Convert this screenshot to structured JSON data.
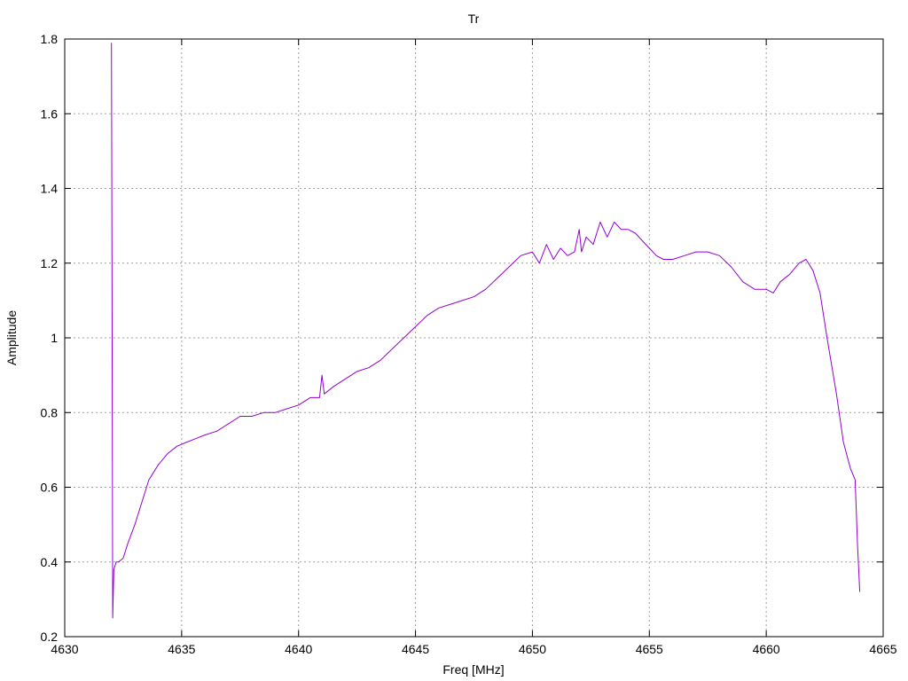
{
  "chart_data": {
    "type": "line",
    "title": "Tr",
    "xlabel": "Freq [MHz]",
    "ylabel": "Amplitude",
    "xlim": [
      4630,
      4665
    ],
    "ylim": [
      0.2,
      1.8
    ],
    "x_ticks": [
      4630,
      4635,
      4640,
      4645,
      4650,
      4655,
      4660,
      4665
    ],
    "y_ticks": [
      0.2,
      0.4,
      0.6,
      0.8,
      1,
      1.2,
      1.4,
      1.6,
      1.8
    ],
    "x_tick_labels": [
      "4630",
      "4635",
      "4640",
      "4645",
      "4650",
      "4655",
      "4660",
      "4665"
    ],
    "y_tick_labels": [
      "0.2",
      "0.4",
      "0.6",
      "0.8",
      "1",
      "1.2",
      "1.4",
      "1.6",
      "1.8"
    ],
    "grid": true,
    "line_color": "#9400d3",
    "series": [
      {
        "x": [
          4632.0,
          4632.02,
          4632.05,
          4632.1,
          4632.2,
          4632.3,
          4632.5,
          4632.7,
          4633.0,
          4633.3,
          4633.6,
          4634.0,
          4634.4,
          4634.8,
          4635.2,
          4635.6,
          4636.0,
          4636.5,
          4637.0,
          4637.5,
          4638.0,
          4638.5,
          4639.0,
          4639.5,
          4640.0,
          4640.5,
          4640.9,
          4641.0,
          4641.1,
          4641.5,
          4642.0,
          4642.5,
          4643.0,
          4643.5,
          4644.0,
          4644.5,
          4645.0,
          4645.5,
          4646.0,
          4646.5,
          4647.0,
          4647.5,
          4648.0,
          4648.5,
          4649.0,
          4649.5,
          4650.0,
          4650.3,
          4650.6,
          4650.9,
          4651.2,
          4651.5,
          4651.8,
          4652.0,
          4652.1,
          4652.3,
          4652.6,
          4652.9,
          4653.2,
          4653.5,
          4653.8,
          4654.1,
          4654.4,
          4654.7,
          4655.0,
          4655.3,
          4655.6,
          4656.0,
          4656.5,
          4657.0,
          4657.5,
          4658.0,
          4658.5,
          4659.0,
          4659.5,
          4660.0,
          4660.3,
          4660.6,
          4661.0,
          4661.4,
          4661.7,
          4662.0,
          4662.3,
          4662.6,
          4663.0,
          4663.3,
          4663.6,
          4663.8,
          4663.9,
          4664.0
        ],
        "y": [
          1.79,
          1.2,
          0.25,
          0.38,
          0.4,
          0.4,
          0.41,
          0.45,
          0.5,
          0.56,
          0.62,
          0.66,
          0.69,
          0.71,
          0.72,
          0.73,
          0.74,
          0.75,
          0.77,
          0.79,
          0.79,
          0.8,
          0.8,
          0.81,
          0.82,
          0.84,
          0.84,
          0.9,
          0.85,
          0.87,
          0.89,
          0.91,
          0.92,
          0.94,
          0.97,
          1.0,
          1.03,
          1.06,
          1.08,
          1.09,
          1.1,
          1.11,
          1.13,
          1.16,
          1.19,
          1.22,
          1.23,
          1.2,
          1.25,
          1.21,
          1.24,
          1.22,
          1.23,
          1.29,
          1.23,
          1.27,
          1.25,
          1.31,
          1.27,
          1.31,
          1.29,
          1.29,
          1.28,
          1.26,
          1.24,
          1.22,
          1.21,
          1.21,
          1.22,
          1.23,
          1.23,
          1.22,
          1.19,
          1.15,
          1.13,
          1.13,
          1.12,
          1.15,
          1.17,
          1.2,
          1.21,
          1.18,
          1.12,
          1.0,
          0.85,
          0.72,
          0.65,
          0.62,
          0.45,
          0.32
        ]
      }
    ]
  }
}
